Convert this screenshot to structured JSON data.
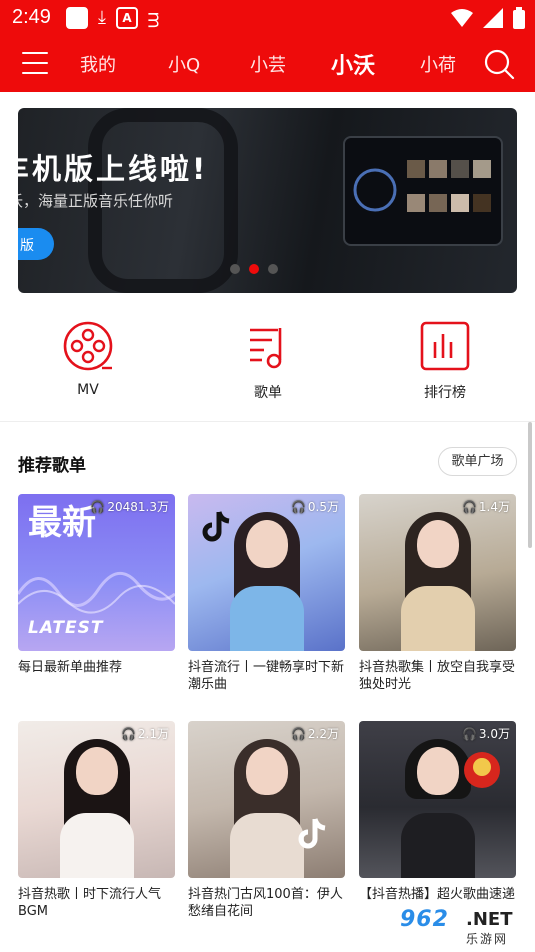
{
  "status_bar": {
    "time": "2:49",
    "left_icons": [
      "app-icon",
      "download-icon",
      "a-icon",
      "custom-icon"
    ],
    "right_icons": [
      "wifi-icon",
      "signal-icon",
      "battery-icon"
    ]
  },
  "nav": {
    "tabs": [
      {
        "label": "我的",
        "active": false
      },
      {
        "label": "小Q",
        "active": false
      },
      {
        "label": "小芸",
        "active": false
      },
      {
        "label": "小沃",
        "active": true
      },
      {
        "label": "小荷",
        "active": false
      }
    ],
    "accent_color": "#ee0b0b"
  },
  "banner": {
    "title": "车机版上线啦!",
    "subtitle": "沃，海量正版音乐任你听",
    "button_label": "版",
    "dots": [
      false,
      true,
      false
    ]
  },
  "quick_actions": [
    {
      "label": "MV",
      "icon": "film-reel-icon"
    },
    {
      "label": "歌单",
      "icon": "playlist-icon"
    },
    {
      "label": "排行榜",
      "icon": "chart-icon"
    }
  ],
  "recommend": {
    "title": "推荐歌单",
    "square_label": "歌单广场",
    "cards": [
      {
        "count": "20481.3万",
        "title": "每日最新单曲推荐",
        "cover_text": "最新",
        "cover_latest": "LATEST"
      },
      {
        "count": "0.5万",
        "title": "抖音流行丨一键畅享时下新潮乐曲"
      },
      {
        "count": "1.4万",
        "title": "抖音热歌集丨放空自我享受独处时光"
      },
      {
        "count": "2.1万",
        "title": "抖音热歌丨时下流行人气BGM"
      },
      {
        "count": "2.2万",
        "title": "抖音热门古风100首：伊人愁绪自花间"
      },
      {
        "count": "3.0万",
        "title": "【抖音热播】超火歌曲速递"
      }
    ]
  },
  "watermark": {
    "number": "962",
    "net": ".NET",
    "sub": "乐游网"
  }
}
